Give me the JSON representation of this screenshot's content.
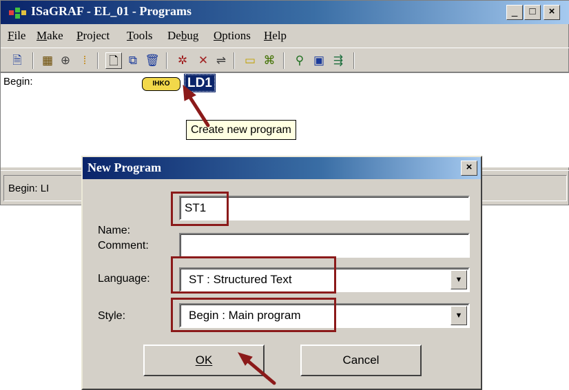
{
  "window": {
    "title": "ISaGRAF - EL_01 - Programs",
    "controls": {
      "minimize": "_",
      "maximize": "□",
      "close": "×"
    }
  },
  "menu": [
    {
      "label": "File",
      "mnemonic": "F"
    },
    {
      "label": "Make",
      "mnemonic": "M"
    },
    {
      "label": "Project",
      "mnemonic": "P"
    },
    {
      "label": "Tools",
      "mnemonic": "T"
    },
    {
      "label": "Debug",
      "mnemonic": "b"
    },
    {
      "label": "Options",
      "mnemonic": "O"
    },
    {
      "label": "Help",
      "mnemonic": "H"
    }
  ],
  "toolbar_icons": [
    "properties-icon",
    "dictionary-icon",
    "link-icon",
    "io-connection-icon",
    "new-program-icon",
    "copy-icon",
    "delete-icon",
    "compile-icon",
    "verify-icon",
    "simulate-icon",
    "code-icon",
    "monitor-icon",
    "connect-icon",
    "debug-icon",
    "spy-icon"
  ],
  "program_list": {
    "section_label": "Begin:",
    "program_name": "LD1",
    "program_type_badge": "IHKO"
  },
  "tooltip": "Create new program",
  "status_bar": {
    "text": "Begin:  LI"
  },
  "dialog": {
    "title": "New Program",
    "close": "×",
    "name_label": "Name:",
    "name_value": "ST1",
    "comment_label": "Comment:",
    "comment_value": "",
    "language_label": "Language:",
    "language_value": "ST : Structured Text",
    "style_label": "Style:",
    "style_value": "Begin : Main program",
    "ok_label": "OK",
    "cancel_label": "Cancel"
  },
  "colors": {
    "highlight_box": "#8b1a1a",
    "arrow": "#8b1a1a",
    "title_bar": "#0a246a",
    "selection": "#0a246a"
  }
}
